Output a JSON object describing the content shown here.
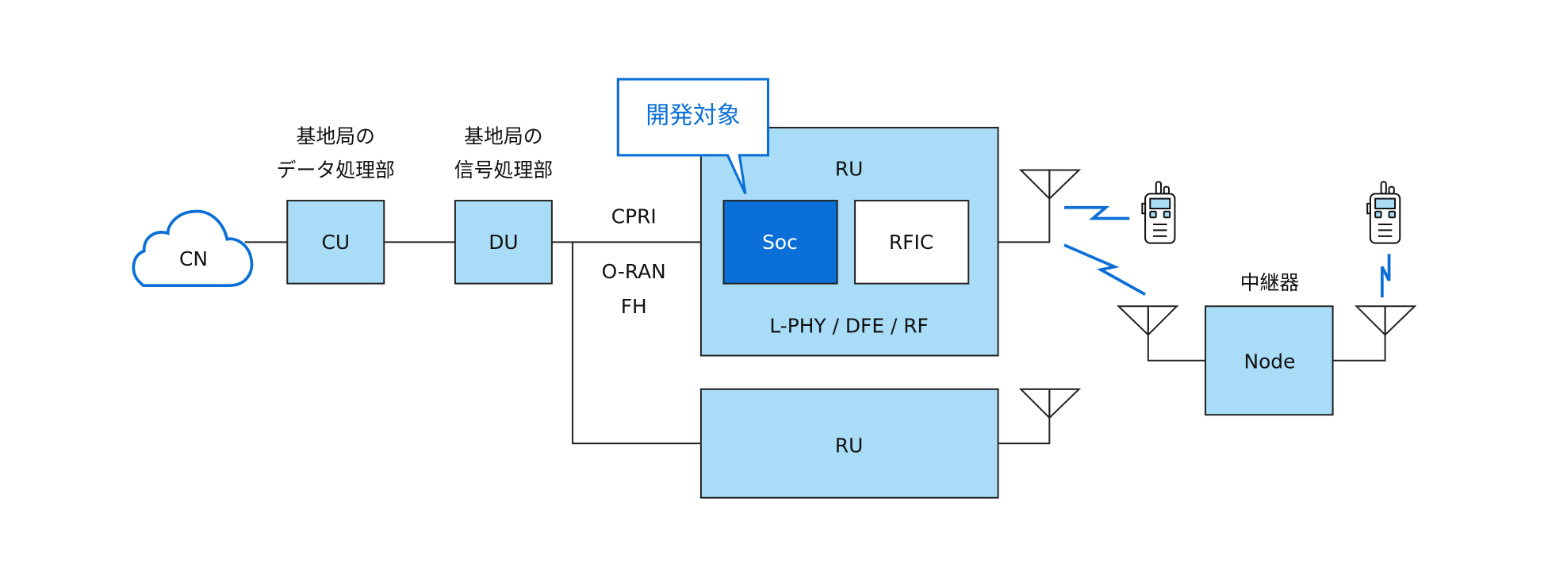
{
  "colors": {
    "node_fill": "#a9dcf6",
    "accent": "#0a6fd6",
    "line": "#222222"
  },
  "cn": {
    "label": "CN",
    "icon": "cloud-icon"
  },
  "cu": {
    "label": "CU",
    "caption_line1": "基地局の",
    "caption_line2": "データ処理部"
  },
  "du": {
    "label": "DU",
    "caption_line1": "基地局の",
    "caption_line2": "信号処理部"
  },
  "fronthaul": {
    "cpri": "CPRI",
    "oran_line1": "O-RAN",
    "oran_line2": "FH"
  },
  "callout": {
    "label": "開発対象"
  },
  "ru1": {
    "label": "RU",
    "soc": "Soc",
    "rfic": "RFIC",
    "footer": "L-PHY / DFE / RF"
  },
  "ru2": {
    "label": "RU"
  },
  "relay": {
    "caption": "中継器",
    "label": "Node"
  },
  "icons": [
    "antenna-icon",
    "radio-handset-icon",
    "wireless-link-icon"
  ]
}
